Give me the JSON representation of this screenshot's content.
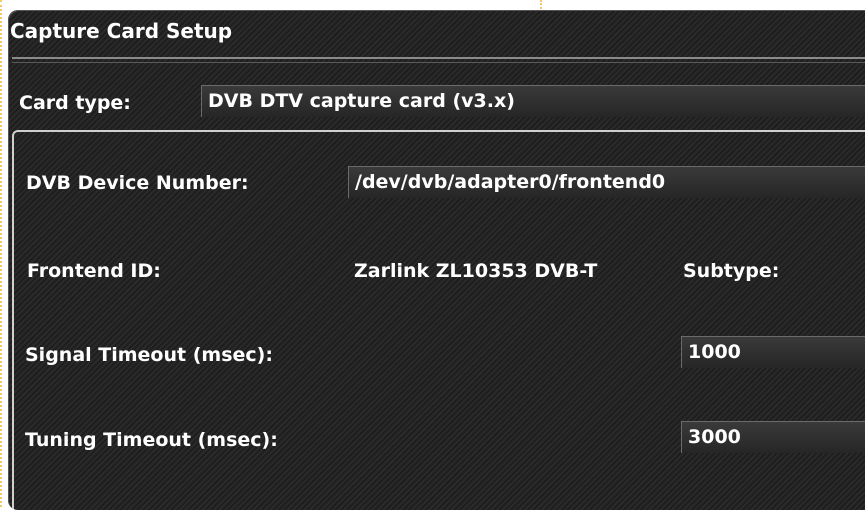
{
  "window": {
    "title": "Capture Card Setup"
  },
  "card_type": {
    "label": "Card type:",
    "value": "DVB DTV capture card (v3.x)"
  },
  "fields": {
    "device_number": {
      "label": "DVB Device Number:",
      "value": "/dev/dvb/adapter0/frontend0"
    },
    "frontend_id": {
      "label": "Frontend ID:",
      "value": "Zarlink ZL10353 DVB-T",
      "subtype_label": "Subtype:"
    },
    "signal_timeout": {
      "label": "Signal Timeout (msec):",
      "value": "1000"
    },
    "tuning_timeout": {
      "label": "Tuning Timeout (msec):",
      "value": "3000"
    }
  },
  "colors": {
    "background": "#1e1e1e",
    "text": "#ffffff",
    "dotted_border": "#f4c76a"
  }
}
